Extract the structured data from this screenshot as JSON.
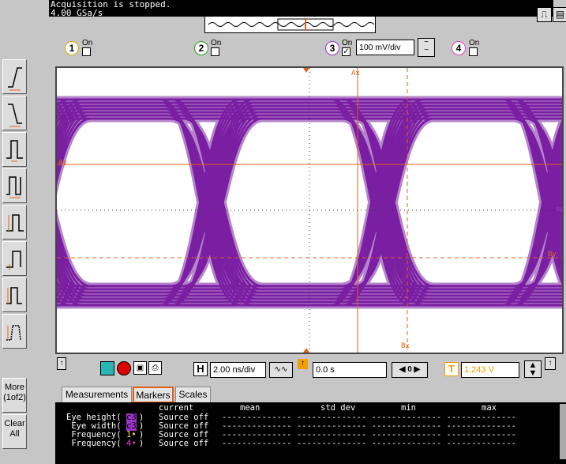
{
  "status": {
    "line1": "Acquisition is stopped.",
    "line2": "4.00 GSa/s"
  },
  "channels": [
    {
      "num": "1",
      "on": "On",
      "checked": false,
      "color": "#ffd54a"
    },
    {
      "num": "2",
      "on": "On",
      "checked": false,
      "color": "#3ad13a"
    },
    {
      "num": "3",
      "on": "On",
      "checked": true,
      "color": "#9a33c8",
      "scale": "100 mV/div"
    },
    {
      "num": "4",
      "on": "On",
      "checked": false,
      "color": "#e040c8"
    }
  ],
  "left_panel": {
    "more": "More\n(1of2)",
    "clear": "Clear\nAll"
  },
  "markers": {
    "ax": "Ax",
    "ay": "Ay",
    "bx": "Bx",
    "by": "By"
  },
  "timebase": {
    "h_label": "H",
    "scale": "2.00 ns/div",
    "position": "0.0 s",
    "t_label": "T",
    "trigger_level": "1.243 V"
  },
  "tabs": {
    "measurements": "Measurements",
    "markers": "Markers",
    "scales": "Scales"
  },
  "meas_headers": {
    "current": "current",
    "mean": "mean",
    "std_dev": "std dev",
    "min": "min",
    "max": "max"
  },
  "meas_rows": [
    {
      "name": "Eye height(",
      "src": "c3",
      "tail": ")",
      "current": "Source off",
      "dashes": "-------------- -------------- -------------- --------------"
    },
    {
      "name": " Eye width(",
      "src": "c3",
      "tail": ")",
      "current": "Source off",
      "dashes": "-------------- -------------- -------------- --------------"
    },
    {
      "name": " Frequency(",
      "src": "1•",
      "tail": ")",
      "current": "Source off",
      "dashes": "-------------- -------------- -------------- --------------"
    },
    {
      "name": " Frequency(",
      "src": "4•",
      "tail": ")",
      "current": "Source off",
      "dashes": "-------------- -------------- -------------- --------------"
    }
  ],
  "colors": {
    "trace": "#7a1fa2",
    "marker": "#e0621a",
    "status_bg": "#000000"
  }
}
